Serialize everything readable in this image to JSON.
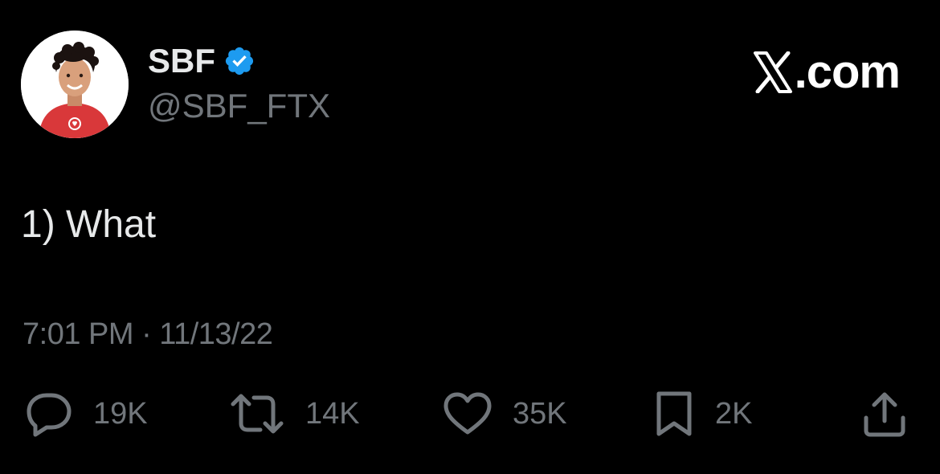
{
  "author": {
    "display_name": "SBF",
    "handle": "@SBF_FTX",
    "verified": true,
    "avatar_icon": "avatar-illustration"
  },
  "brand": {
    "label": ".com",
    "icon": "x-logo-icon"
  },
  "tweet": {
    "text": "1) What",
    "timestamp": "7:01 PM · 11/13/22"
  },
  "actions": {
    "reply": {
      "icon": "reply-icon",
      "count": "19K"
    },
    "retweet": {
      "icon": "retweet-icon",
      "count": "14K"
    },
    "like": {
      "icon": "heart-icon",
      "count": "35K"
    },
    "bookmark": {
      "icon": "bookmark-icon",
      "count": "2K"
    },
    "share": {
      "icon": "share-icon"
    }
  },
  "colors": {
    "background": "#000000",
    "primary_text": "#e7e9ea",
    "secondary_text": "#71767b",
    "verified_blue": "#1d9bf0",
    "shirt_red": "#d9383a"
  }
}
